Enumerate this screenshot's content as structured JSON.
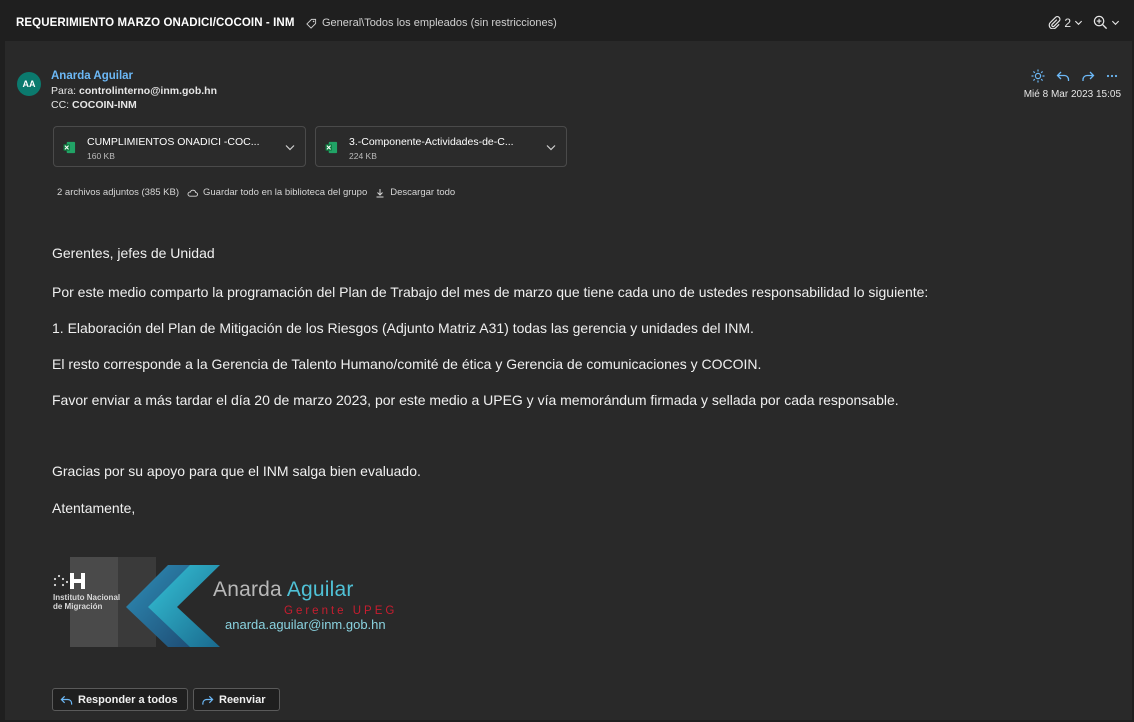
{
  "header": {
    "subject": "REQUERIMIENTO MARZO ONADICI/COCOIN - INM",
    "label": "General\\Todos los empleados (sin restricciones)",
    "attachment_count": "2"
  },
  "message": {
    "avatar_initials": "AA",
    "sender_name": "Anarda Aguilar",
    "to_prefix": "Para:",
    "to_address": "controlinterno@inm.gob.hn",
    "cc_prefix": "CC:",
    "cc_address": "COCOIN-INM",
    "date": "Mié 8 Mar 2023 15:05"
  },
  "attachments": [
    {
      "name": "CUMPLIMIENTOS ONADICI -COC...",
      "size": "160 KB",
      "type": "excel"
    },
    {
      "name": "3.-Componente-Actividades-de-C...",
      "size": "224 KB",
      "type": "excel"
    }
  ],
  "attachment_summary": {
    "text": "2 archivos adjuntos (385 KB)",
    "save_all": "Guardar todo en la biblioteca del grupo",
    "download_all": "Descargar todo"
  },
  "body": {
    "greeting": "Gerentes, jefes de Unidad",
    "p1": "Por este medio comparto la programación del Plan de Trabajo del mes de marzo que tiene cada uno de ustedes responsabilidad lo siguiente:",
    "p2": "1. Elaboración del Plan de Mitigación de los Riesgos (Adjunto Matriz A31) todas las gerencia y unidades del INM.",
    "p3": "El resto corresponde a la Gerencia de Talento Humano/comité de ética y Gerencia de comunicaciones y COCOIN.",
    "p4": "Favor enviar a más tardar el día 20 de marzo 2023, por este medio a UPEG y vía memorándum firmada y sellada por cada responsable.",
    "p5": "Gracias por su apoyo para que el INM salga bien evaluado.",
    "closing": "Atentamente,"
  },
  "signature": {
    "logo_letters": "H",
    "institution_line1": "Instituto Nacional",
    "institution_line2": "de Migración",
    "name_first": "Anarda",
    "name_last": "Aguilar",
    "title": "Gerente UPEG",
    "email": "anarda.aguilar@inm.gob.hn"
  },
  "footer": {
    "reply_all": "Responder a todos",
    "forward": "Reenviar"
  },
  "colors": {
    "accent": "#6cb8f6",
    "avatar_bg": "#0b7a6e",
    "signature_red": "#c71d2f",
    "signature_teal": "#4fc1d6"
  }
}
